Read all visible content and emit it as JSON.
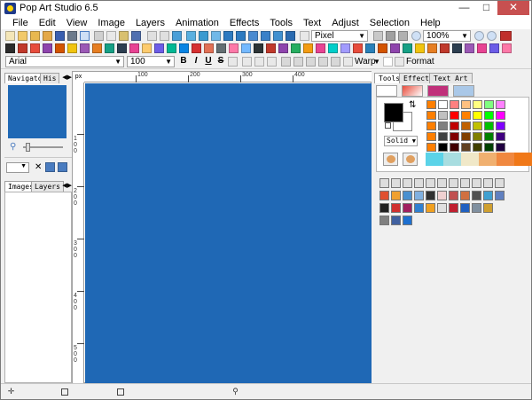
{
  "window": {
    "title": "Pop Art Studio 6.5",
    "minimize": "—",
    "maximize": "□",
    "close": "✕"
  },
  "menu": [
    "File",
    "Edit",
    "View",
    "Image",
    "Layers",
    "Animation",
    "Effects",
    "Tools",
    "Text",
    "Adjust",
    "Selection",
    "Help"
  ],
  "toolbar1": {
    "unit": "Pixel",
    "zoom": "100%"
  },
  "toolbar2": {},
  "formatbar": {
    "font": "Arial",
    "size": "100",
    "bold": "B",
    "italic": "I",
    "underline": "U",
    "strike": "S",
    "warp_label": "Warp",
    "format_label": "Format"
  },
  "left_panel": {
    "tabs": [
      "Navigator",
      "His"
    ],
    "bottom_tabs": [
      "Images",
      "Layers"
    ],
    "canvas_color": "#1f68b5"
  },
  "ruler": {
    "unit_label": "px",
    "top_labels": [
      "100",
      "200",
      "300",
      "400"
    ],
    "left_labels": [
      "1 0 0",
      "2 0 0",
      "3 0 0",
      "4 0 0",
      "5 0 0"
    ]
  },
  "right_panel": {
    "tabs": [
      "Tools",
      "Effects",
      "Text Art"
    ],
    "style_select": "Solid",
    "foreground": "#000000",
    "background": "#ffffff",
    "swatches": [
      [
        "#ff7f00",
        "#ffffff",
        "#ff8080",
        "#ffc080",
        "#ffff80",
        "#80ff80",
        "#80ffff",
        "#ff80ff"
      ],
      [
        "#ff7f00",
        "#c0c0c0",
        "#ff0000",
        "#ff8000",
        "#ffff00",
        "#00ff00",
        "#00ffff",
        "#ff00ff"
      ],
      [
        "#ff7f00",
        "#808080",
        "#c00000",
        "#c06000",
        "#c0c000",
        "#00c000",
        "#00c0c0",
        "#8000ff"
      ],
      [
        "#ff7f00",
        "#404040",
        "#800000",
        "#804000",
        "#808000",
        "#008000",
        "#008080",
        "#400080"
      ],
      [
        "#ff7f00",
        "#000000",
        "#400000",
        "#604020",
        "#404000",
        "#004000",
        "#004040",
        "#200040"
      ]
    ],
    "bottom_strip": [
      "#5bd3e8",
      "#a8dde0",
      "#f0e8c8",
      "#f0b070",
      "#f08840",
      "#f07818"
    ]
  },
  "colors": {
    "canvas": "#1f68b5",
    "close": "#c75050"
  }
}
